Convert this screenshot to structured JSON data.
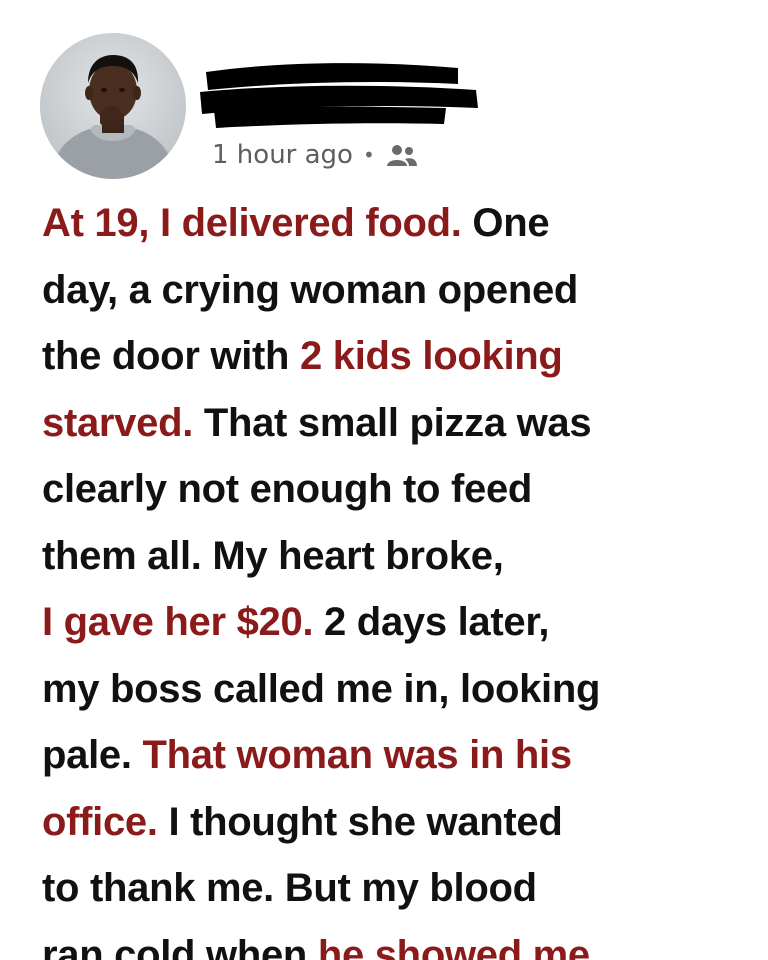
{
  "post": {
    "timestamp": "1 hour ago",
    "separator": "•",
    "audience_icon": "friends-icon",
    "author_name_redacted": true,
    "highlight_color": "#8b1a1a",
    "text_color": "#111111",
    "lines": [
      [
        {
          "t": "At 19, I delivered food.",
          "hl": true
        },
        {
          "t": " One",
          "hl": false
        }
      ],
      [
        {
          "t": "day, a crying woman opened",
          "hl": false
        }
      ],
      [
        {
          "t": "the door with ",
          "hl": false
        },
        {
          "t": "2 kids looking",
          "hl": true
        }
      ],
      [
        {
          "t": "starved.",
          "hl": true
        },
        {
          "t": " That small pizza was",
          "hl": false
        }
      ],
      [
        {
          "t": "clearly not enough to feed",
          "hl": false
        }
      ],
      [
        {
          "t": "them all. My heart broke,",
          "hl": false
        }
      ],
      [
        {
          "t": "I gave her $20.",
          "hl": true
        },
        {
          "t": " 2 days later,",
          "hl": false
        }
      ],
      [
        {
          "t": "my boss called me in, looking",
          "hl": false
        }
      ],
      [
        {
          "t": "pale. ",
          "hl": false
        },
        {
          "t": "That woman was in his",
          "hl": true
        }
      ],
      [
        {
          "t": "office.",
          "hl": true
        },
        {
          "t": " I thought she wanted",
          "hl": false
        }
      ],
      [
        {
          "t": "to thank me. But my blood",
          "hl": false
        }
      ],
      [
        {
          "t": "ran cold when ",
          "hl": false
        },
        {
          "t": "he showed me",
          "hl": true
        }
      ]
    ]
  }
}
